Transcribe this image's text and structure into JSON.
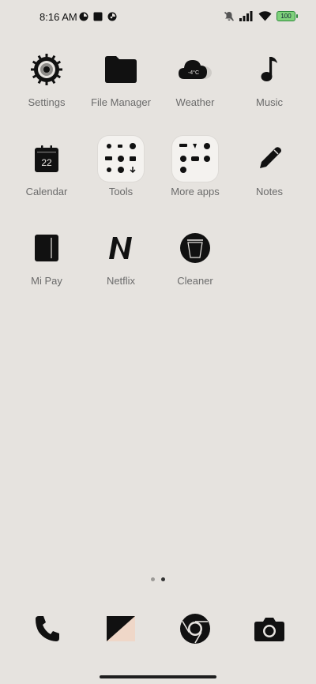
{
  "status_bar": {
    "time": "8:16 AM",
    "battery": "100"
  },
  "apps": [
    {
      "label": "Settings",
      "icon": "gear-icon"
    },
    {
      "label": "File Manager",
      "icon": "folder-icon"
    },
    {
      "label": "Weather",
      "icon": "weather-cloud-icon",
      "temp": "-4°C"
    },
    {
      "label": "Music",
      "icon": "music-note-icon"
    },
    {
      "label": "Calendar",
      "icon": "calendar-icon",
      "day": "22"
    },
    {
      "label": "Tools",
      "icon": "tools-folder-icon"
    },
    {
      "label": "More apps",
      "icon": "more-apps-folder-icon"
    },
    {
      "label": "Notes",
      "icon": "pencil-icon"
    },
    {
      "label": "Mi Pay",
      "icon": "wallet-icon"
    },
    {
      "label": "Netflix",
      "icon": "netflix-icon"
    },
    {
      "label": "Cleaner",
      "icon": "trash-bin-icon"
    }
  ],
  "dock": [
    {
      "icon": "phone-icon"
    },
    {
      "icon": "messages-icon"
    },
    {
      "icon": "chrome-icon"
    },
    {
      "icon": "camera-icon"
    }
  ],
  "page_indicator": {
    "pages": 2,
    "active": 2
  }
}
